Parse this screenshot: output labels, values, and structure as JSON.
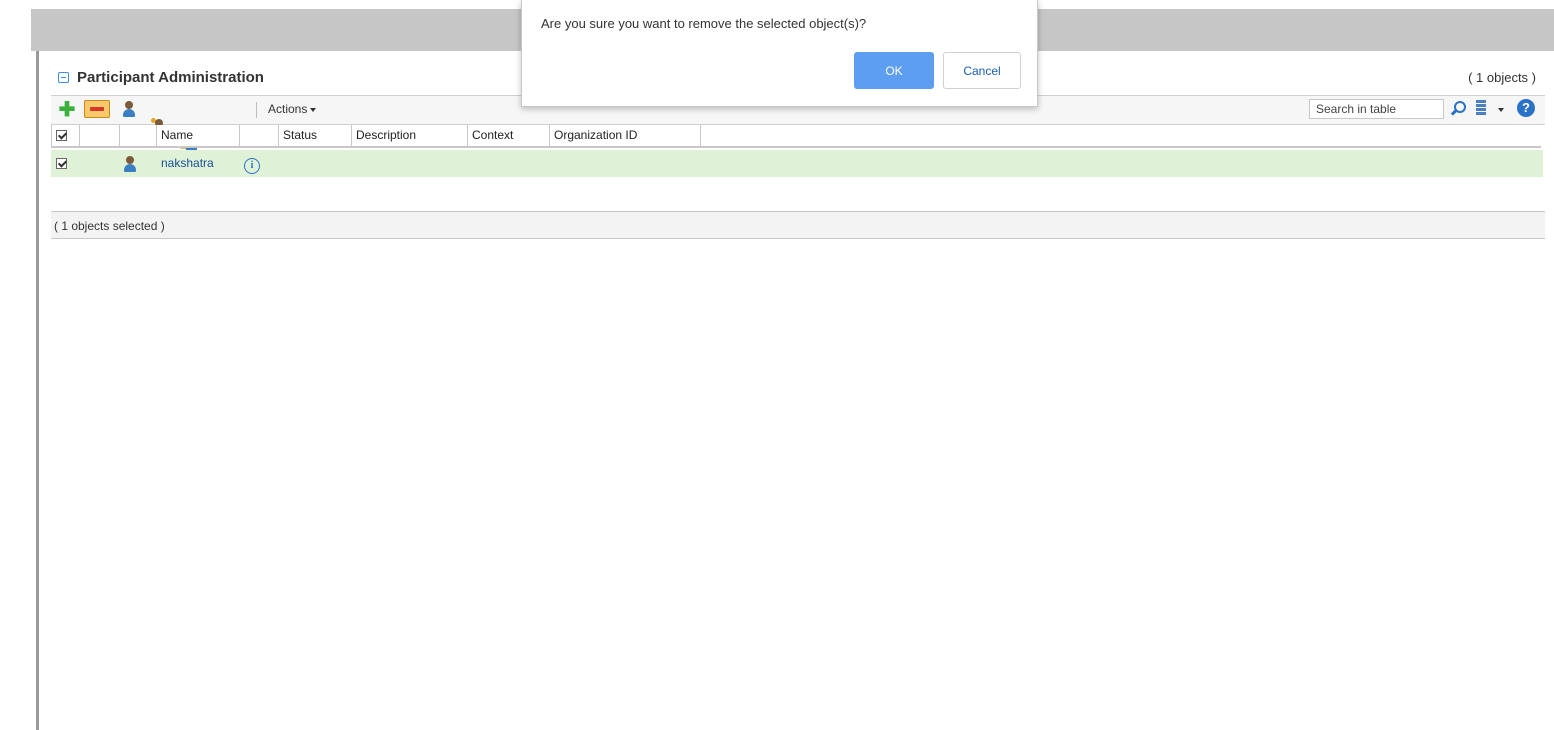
{
  "panel": {
    "title": "Participant Administration",
    "count": "( 1 objects )"
  },
  "toolbar": {
    "actions_label": "Actions",
    "search_placeholder": "Search in table"
  },
  "table": {
    "columns": [
      "Name",
      "Status",
      "Description",
      "Context",
      "Organization ID"
    ],
    "rows": [
      {
        "name": "nakshatra",
        "selected": true
      }
    ]
  },
  "footer": {
    "selection_text": "( 1 objects selected )"
  },
  "dialog": {
    "message": "Are you sure you want to remove the selected object(s)?",
    "ok_label": "OK",
    "cancel_label": "Cancel"
  },
  "colors": {
    "accent": "#5d9ef0",
    "selected_row": "#dff2d8",
    "header_band": "#c6c6c6"
  },
  "icons": [
    "collapse-icon",
    "add-icon",
    "remove-icon",
    "user-icon",
    "new-user-icon",
    "group-icon",
    "search-icon",
    "columns-icon",
    "help-icon",
    "info-icon"
  ]
}
